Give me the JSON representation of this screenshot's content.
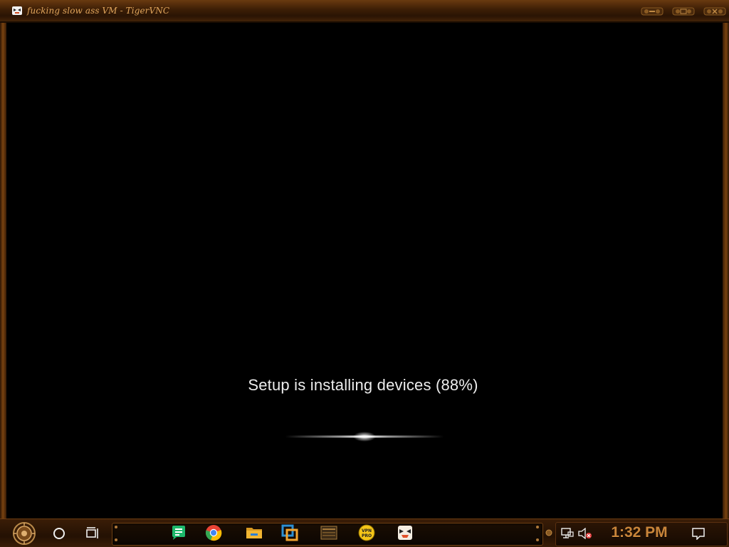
{
  "window": {
    "title": "fucking slow ass VM - TigerVNC",
    "icon": "tigervnc-icon",
    "controls": [
      "minimize-button",
      "maximize-button",
      "close-button"
    ]
  },
  "vm_screen": {
    "status_text": "Setup is installing devices (88%)",
    "progress_percent": 88
  },
  "taskbar": {
    "start": "start-button",
    "search": "search-circle-icon",
    "task_view": "task-view-icon",
    "pinned_apps": [
      {
        "name": "notes-app-icon",
        "color": "#1db86b"
      },
      {
        "name": "chrome-icon",
        "color": "#e94335"
      },
      {
        "name": "file-explorer-icon",
        "color": "#f2b632"
      },
      {
        "name": "virtualbox-icon",
        "color": "#2d8fd3"
      },
      {
        "name": "game-launcher-icon",
        "color": "#a57a3c"
      },
      {
        "name": "vpn-pro-icon",
        "color": "#f5c518",
        "label": "VPN\nPRO"
      },
      {
        "name": "tigervnc-taskbar-icon",
        "color": "#e0502a"
      }
    ],
    "tray": {
      "network": "network-icon",
      "volume": "volume-muted-icon",
      "clock": "1:32 PM",
      "notifications": "action-center-icon"
    }
  },
  "colors": {
    "frame_accent": "#7a4310",
    "title_text": "#e0a55c",
    "clock_text": "#c9853a"
  }
}
